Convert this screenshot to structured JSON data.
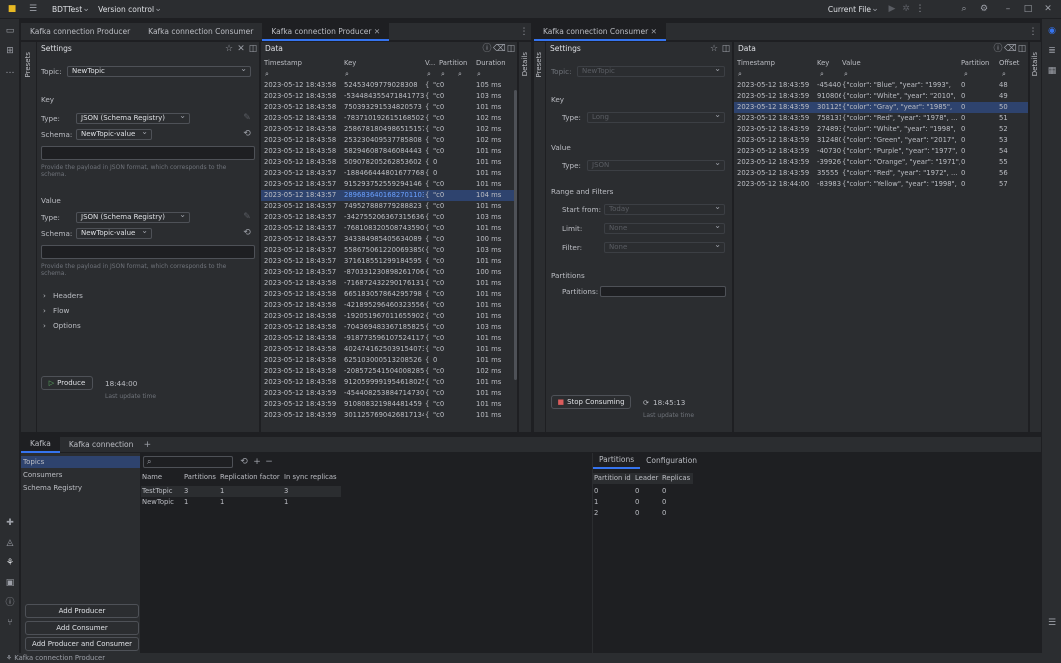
{
  "app": {
    "project": "BDTTest",
    "vcs": "Version control",
    "run_config": "Current File"
  },
  "editor_tabs": [
    {
      "label": "Kafka connection Producer"
    },
    {
      "label": "Kafka connection Consumer"
    },
    {
      "label": "Kafka connection Producer"
    },
    {
      "label": "Kafka connection Consumer"
    }
  ],
  "producer": {
    "settings_title": "Settings",
    "presets_label": "Presets",
    "data_title": "Data",
    "details_label": "Details",
    "topic_label": "Topic:",
    "topic_value": "NewTopic",
    "key_section": "Key",
    "key_type_label": "Type:",
    "key_type_value": "JSON (Schema Registry)",
    "key_schema_label": "Schema:",
    "key_schema_value": "NewTopic-value",
    "key_hint": "Provide the payload in JSON format, which corresponds to the schema.",
    "value_section": "Value",
    "value_type_label": "Type:",
    "value_type_value": "JSON (Schema Registry)",
    "value_schema_label": "Schema:",
    "value_schema_value": "NewTopic-value",
    "value_hint": "Provide the payload in JSON format, which corresponds to the schema.",
    "headers": "Headers",
    "flow": "Flow",
    "options": "Options",
    "produce_button": "Produce",
    "time": "18:44:00",
    "last_update": "Last update time",
    "columns": [
      "Timestamp",
      "Key",
      "V...",
      "Partition",
      "Duration"
    ],
    "rows": [
      [
        "2023-05-12 18:43:58",
        "52453409779028308",
        "{",
        "\"c0",
        "105 ms"
      ],
      [
        "2023-05-12 18:43:58",
        "-5344843554718417731",
        "{",
        "\"c0",
        "103 ms"
      ],
      [
        "2023-05-12 18:43:58",
        "750393291534820573",
        "{",
        "\"c0",
        "101 ms"
      ],
      [
        "2023-05-12 18:43:58",
        "-78371019261516850260",
        "{",
        "\"c0",
        "102 ms"
      ],
      [
        "2023-05-12 18:43:58",
        "25867818049865151570",
        "{",
        "\"c0",
        "102 ms"
      ],
      [
        "2023-05-12 18:43:58",
        "253230409537785808",
        "{",
        "\"c0",
        "102 ms"
      ],
      [
        "2023-05-12 18:43:58",
        "582946087846084443",
        "{",
        "\"c0",
        "101 ms"
      ],
      [
        "2023-05-12 18:43:58",
        "509078205262853602",
        "{",
        "0",
        "101 ms"
      ],
      [
        "2023-05-12 18:43:57",
        "-188466444801677768",
        "{",
        "0",
        "101 ms"
      ],
      [
        "2023-05-12 18:43:57",
        "915293752559294146",
        "{",
        "\"c0",
        "101 ms"
      ],
      [
        "2023-05-12 18:43:57",
        "2896836401682701103",
        "{",
        "\"c0",
        "104 ms"
      ],
      [
        "2023-05-12 18:43:57",
        "749527888779288823",
        "{",
        "\"c0",
        "101 ms"
      ],
      [
        "2023-05-12 18:43:57",
        "-342755206367315636",
        "{",
        "\"c0",
        "103 ms"
      ],
      [
        "2023-05-12 18:43:57",
        "-7681083205087435900",
        "{",
        "\"c0",
        "101 ms"
      ],
      [
        "2023-05-12 18:43:57",
        "343384985405634089",
        "{",
        "\"c0",
        "100 ms"
      ],
      [
        "2023-05-12 18:43:57",
        "5586750612200693850",
        "{",
        "\"c0",
        "103 ms"
      ],
      [
        "2023-05-12 18:43:57",
        "371618551299184595",
        "{",
        "\"c0",
        "101 ms"
      ],
      [
        "2023-05-12 18:43:57",
        "-870331230898261706",
        "{",
        "\"c0",
        "100 ms"
      ],
      [
        "2023-05-12 18:43:58",
        "-7168724322901761310",
        "{",
        "\"c0",
        "101 ms"
      ],
      [
        "2023-05-12 18:43:58",
        "665183057864295798",
        "{",
        "\"c0",
        "101 ms"
      ],
      [
        "2023-05-12 18:43:58",
        "-421895296460323556",
        "{",
        "\"c0",
        "101 ms"
      ],
      [
        "2023-05-12 18:43:58",
        "-1920519670116559020",
        "{",
        "\"c0",
        "101 ms"
      ],
      [
        "2023-05-12 18:43:58",
        "-7043694833671858250",
        "{",
        "\"c0",
        "103 ms"
      ],
      [
        "2023-05-12 18:43:58",
        "-9187735961075241178",
        "{",
        "\"c0",
        "101 ms"
      ],
      [
        "2023-05-12 18:43:58",
        "4024741625039154073",
        "{",
        "\"c0",
        "101 ms"
      ],
      [
        "2023-05-12 18:43:58",
        "625103000513208526",
        "{",
        "0",
        "101 ms"
      ],
      [
        "2023-05-12 18:43:58",
        "-2085725415040082850",
        "{",
        "\"c0",
        "102 ms"
      ],
      [
        "2023-05-12 18:43:58",
        "9120599991954618025",
        "{",
        "\"c0",
        "101 ms"
      ],
      [
        "2023-05-12 18:43:59",
        "-454408253884714730",
        "{",
        "\"c0",
        "101 ms"
      ],
      [
        "2023-05-12 18:43:59",
        "910808321984481459",
        "{",
        "\"c0",
        "101 ms"
      ],
      [
        "2023-05-12 18:43:59",
        "3011257690426817134",
        "{",
        "\"c0",
        "101 ms"
      ]
    ]
  },
  "consumer": {
    "settings_title": "Settings",
    "presets_label": "Presets",
    "data_title": "Data",
    "details_label": "Details",
    "topic_label": "Topic:",
    "topic_value": "NewTopic",
    "key_section": "Key",
    "key_type_label": "Type:",
    "key_type_value": "Long",
    "value_section": "Value",
    "value_type_label": "Type:",
    "value_type_value": "JSON",
    "range_section": "Range and Filters",
    "start_label": "Start from:",
    "start_value": "Today",
    "limit_label": "Limit:",
    "limit_value": "None",
    "filter_label": "Filter:",
    "filter_value": "None",
    "partitions_section": "Partitions",
    "partitions_label": "Partitions:",
    "stop_button": "Stop Consuming",
    "time": "18:45:13",
    "last_update": "Last update time",
    "columns": [
      "Timestamp",
      "Key",
      "Value",
      "Partition",
      "Offset"
    ],
    "rows": [
      [
        "2023-05-12 18:43:59",
        "-45440",
        "{\"color\": \"Blue\", \"year\": \"1993\",",
        "0",
        "48"
      ],
      [
        "2023-05-12 18:43:59",
        "910806",
        "{\"color\": \"White\", \"year\": \"2010\",",
        "0",
        "49"
      ],
      [
        "2023-05-12 18:43:59",
        "301125",
        "{\"color\": \"Gray\", \"year\": \"1985\",",
        "0",
        "50"
      ],
      [
        "2023-05-12 18:43:59",
        "758131",
        "{\"color\": \"Red\", \"year\": \"1978\", ...",
        "0",
        "51"
      ],
      [
        "2023-05-12 18:43:59",
        "274893",
        "{\"color\": \"White\", \"year\": \"1998\",",
        "0",
        "52"
      ],
      [
        "2023-05-12 18:43:59",
        "312480",
        "{\"color\": \"Green\", \"year\": \"2017\",",
        "0",
        "53"
      ],
      [
        "2023-05-12 18:43:59",
        "-40730",
        "{\"color\": \"Purple\", \"year\": \"1977\",",
        "0",
        "54"
      ],
      [
        "2023-05-12 18:43:59",
        "-39926",
        "{\"color\": \"Orange\", \"year\": \"1971\",",
        "0",
        "55"
      ],
      [
        "2023-05-12 18:43:59",
        "35555",
        "{\"color\": \"Red\", \"year\": \"1972\", ...",
        "0",
        "56"
      ],
      [
        "2023-05-12 18:44:00",
        "-83983",
        "{\"color\": \"Yellow\", \"year\": \"1998\",",
        "0",
        "57"
      ]
    ]
  },
  "bottom": {
    "tabs": [
      "Kafka",
      "Kafka connection"
    ],
    "sidebar": [
      "Topics",
      "Consumers",
      "Schema Registry"
    ],
    "buttons": [
      "Add Producer",
      "Add Consumer",
      "Add Producer and Consumer"
    ],
    "topic_columns": [
      "Name",
      "Partitions",
      "Replication factor",
      "In sync replicas"
    ],
    "topics": [
      [
        "TestTopic",
        "3",
        "1",
        "3"
      ],
      [
        "NewTopic",
        "1",
        "1",
        "1"
      ]
    ],
    "right_tabs": [
      "Partitions",
      "Configuration"
    ],
    "partition_columns": [
      "Partition id",
      "Leader",
      "Replicas"
    ],
    "partitions": [
      [
        "0",
        "0",
        "0"
      ],
      [
        "1",
        "0",
        "0"
      ],
      [
        "2",
        "0",
        "0"
      ]
    ]
  },
  "status": {
    "text": "Kafka connection Producer"
  }
}
